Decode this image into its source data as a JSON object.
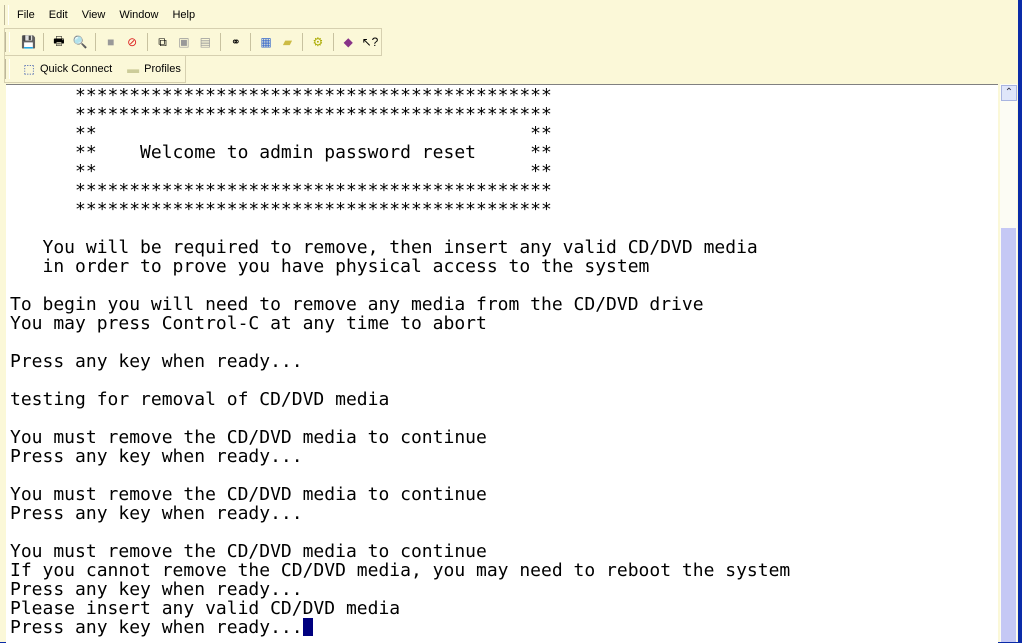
{
  "menu": [
    "File",
    "Edit",
    "View",
    "Window",
    "Help"
  ],
  "toolbar_icons": [
    "save-icon",
    "print-icon",
    "print-preview-icon",
    "connect-icon",
    "disconnect-icon",
    "copy-icon",
    "paste-icon",
    "paste-special-icon",
    "find-icon",
    "session-options-icon",
    "global-options-icon",
    "keymap-icon",
    "help-book-icon",
    "whats-this-icon"
  ],
  "connect_bar": {
    "quick_connect": "Quick Connect",
    "profiles": "Profiles"
  },
  "terminal": {
    "lines": [
      "      ********************************************",
      "      ********************************************",
      "      **                                        **",
      "      **    Welcome to admin password reset     **",
      "      **                                        **",
      "      ********************************************",
      "      ********************************************",
      "",
      "   You will be required to remove, then insert any valid CD/DVD media",
      "   in order to prove you have physical access to the system",
      "",
      "To begin you will need to remove any media from the CD/DVD drive",
      "You may press Control-C at any time to abort",
      "",
      "Press any key when ready...",
      "",
      "testing for removal of CD/DVD media",
      "",
      "You must remove the CD/DVD media to continue",
      "Press any key when ready...",
      "",
      "You must remove the CD/DVD media to continue",
      "Press any key when ready...",
      "",
      "You must remove the CD/DVD media to continue",
      "If you cannot remove the CD/DVD media, you may need to reboot the system",
      "Press any key when ready...",
      "Please insert any valid CD/DVD media",
      "Press any key when ready..."
    ]
  },
  "colors": {
    "chrome": "#fbf8d8",
    "cursor": "#00007f",
    "frame": "#0a2ba8"
  }
}
